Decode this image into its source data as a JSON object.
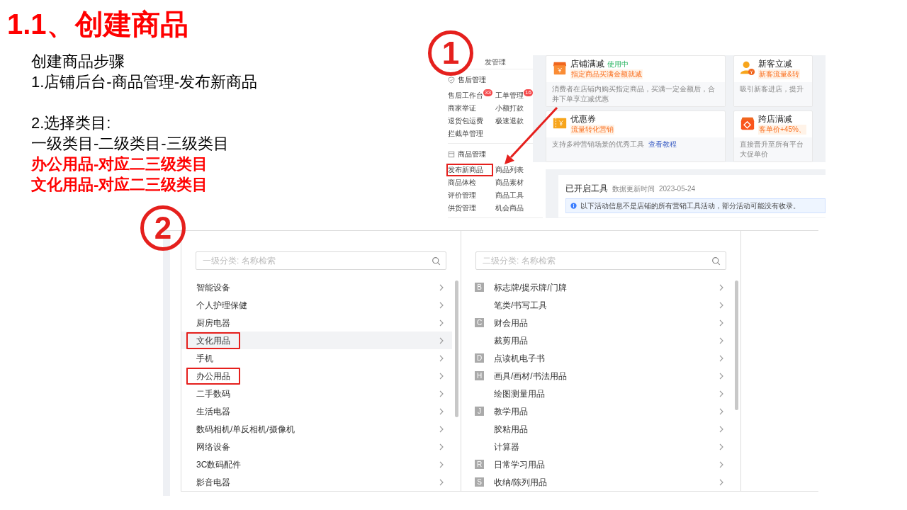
{
  "slide_title": "1.1、创建商品",
  "step_groups": [
    [
      {
        "kind": "plain",
        "text": "创建商品步骤"
      },
      {
        "kind": "plain",
        "text": "1.店铺后台-商品管理-发布新商品"
      }
    ],
    [
      {
        "kind": "plain",
        "text": "2.选择类目:"
      },
      {
        "kind": "plain",
        "text": "一级类目-二级类目-三级类目"
      },
      {
        "kind": "highlight",
        "text": "办公用品-对应二三级类目"
      },
      {
        "kind": "highlight",
        "text": "文化用品-对应二三级类目"
      }
    ]
  ],
  "markers": [
    "1",
    "2"
  ],
  "backend": {
    "sidebar": {
      "partial_item": "发管理",
      "sections": [
        {
          "title": "售后管理",
          "items": [
            {
              "label": "售后工作台",
              "badge": "33",
              "boxed": false
            },
            {
              "label": "工单管理",
              "badge": "16",
              "boxed": false
            },
            {
              "label": "商家举证",
              "boxed": false
            },
            {
              "label": "小额打款",
              "boxed": false
            },
            {
              "label": "退货包运费",
              "boxed": false
            },
            {
              "label": "极速退款",
              "boxed": false
            },
            {
              "label": "拦截单管理",
              "boxed": false
            }
          ]
        },
        {
          "title": "商品管理",
          "items": [
            {
              "label": "发布新商品",
              "boxed": true
            },
            {
              "label": "商品列表",
              "boxed": false
            },
            {
              "label": "商品体检",
              "boxed": false
            },
            {
              "label": "商品素材",
              "boxed": false
            },
            {
              "label": "评价管理",
              "boxed": false
            },
            {
              "label": "商品工具",
              "boxed": false
            },
            {
              "label": "供货管理",
              "boxed": false
            },
            {
              "label": "机会商品",
              "boxed": false
            }
          ]
        }
      ]
    },
    "tools": [
      {
        "title": "店铺满减",
        "status": "使用中",
        "subtitle": "指定商品买满金额就减",
        "description": "消费者在店铺内购买指定商品，买满一定金额后，合并下单享立减优惠"
      },
      {
        "title": "新客立减",
        "subtitle": "新客流量&转",
        "description": "吸引新客进店，提升"
      },
      {
        "title": "优惠券",
        "subtitle": "流量转化营销",
        "description": "支持多种营销场景的优秀工具",
        "link": "查看教程"
      },
      {
        "title": "跨店满减",
        "subtitle": "客单价+45%、",
        "description": "直接晋升至所有平台大促单价"
      }
    ],
    "enabled_tools": {
      "title": "已开启工具",
      "update_label": "数据更新时间",
      "update_date": "2023-05-24",
      "notice": "以下活动信息不是店铺的所有营销工具活动，部分活动可能没有收录。"
    }
  },
  "category_picker": {
    "level1": {
      "placeholder": "一级分类: 名称检索",
      "items": [
        {
          "label": "智能设备",
          "selected": false,
          "boxed": false
        },
        {
          "label": "个人护理保健",
          "selected": false,
          "boxed": false
        },
        {
          "label": "厨房电器",
          "selected": false,
          "boxed": false
        },
        {
          "label": "文化用品",
          "selected": true,
          "boxed": true
        },
        {
          "label": "手机",
          "selected": false,
          "boxed": false
        },
        {
          "label": "办公用品",
          "selected": false,
          "boxed": true
        },
        {
          "label": "二手数码",
          "selected": false,
          "boxed": false
        },
        {
          "label": "生活电器",
          "selected": false,
          "boxed": false
        },
        {
          "label": "数码相机/单反相机/摄像机",
          "selected": false,
          "boxed": false
        },
        {
          "label": "网络设备",
          "selected": false,
          "boxed": false
        },
        {
          "label": "3C数码配件",
          "selected": false,
          "boxed": false
        },
        {
          "label": "影音电器",
          "selected": false,
          "boxed": false
        }
      ]
    },
    "level2": {
      "placeholder": "二级分类: 名称检索",
      "items": [
        {
          "letter": "B",
          "label": "标志牌/提示牌/门牌"
        },
        {
          "label": "笔类/书写工具"
        },
        {
          "letter": "C",
          "label": "财会用品"
        },
        {
          "label": "裁剪用品"
        },
        {
          "letter": "D",
          "label": "点读机电子书"
        },
        {
          "letter": "H",
          "label": "画具/画材/书法用品"
        },
        {
          "label": "绘图测量用品"
        },
        {
          "letter": "J",
          "label": "教学用品"
        },
        {
          "label": "胶粘用品"
        },
        {
          "label": "计算器"
        },
        {
          "letter": "R",
          "label": "日常学习用品"
        },
        {
          "letter": "S",
          "label": "收纳/陈列用品"
        }
      ]
    }
  }
}
